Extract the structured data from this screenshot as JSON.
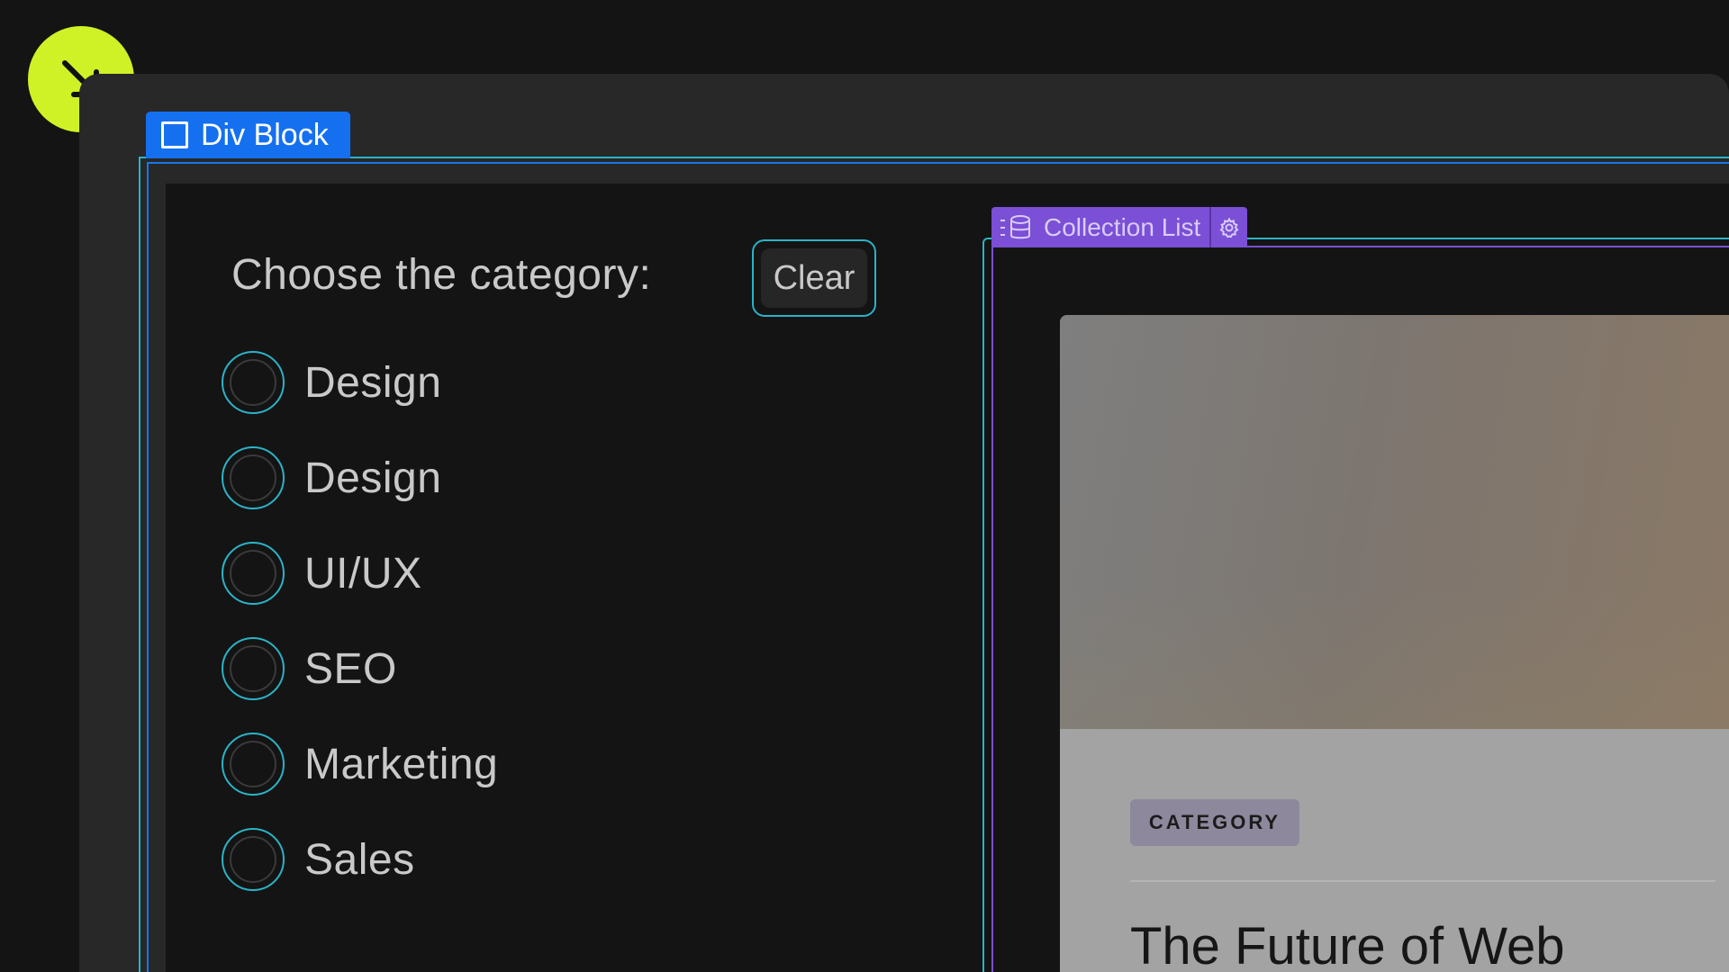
{
  "tags": {
    "div_block": "Div Block",
    "collection_list": "Collection List"
  },
  "filter": {
    "title": "Choose the category:",
    "clear_label": "Clear",
    "categories": [
      "Design",
      "Design",
      "UI/UX",
      "SEO",
      "Marketing",
      "Sales"
    ]
  },
  "card": {
    "category": "CATEGORY",
    "title": "The Future of Web"
  },
  "icons": {
    "cursor": "arrow-down-right-icon",
    "div_block": "square-icon",
    "collection": "database-icon",
    "settings": "gear-icon"
  },
  "colors": {
    "accent_lime": "#cef226",
    "selection_blue": "#1570f0",
    "outline_teal": "#2bb3c7",
    "collection_purple": "#7b4fd6"
  }
}
